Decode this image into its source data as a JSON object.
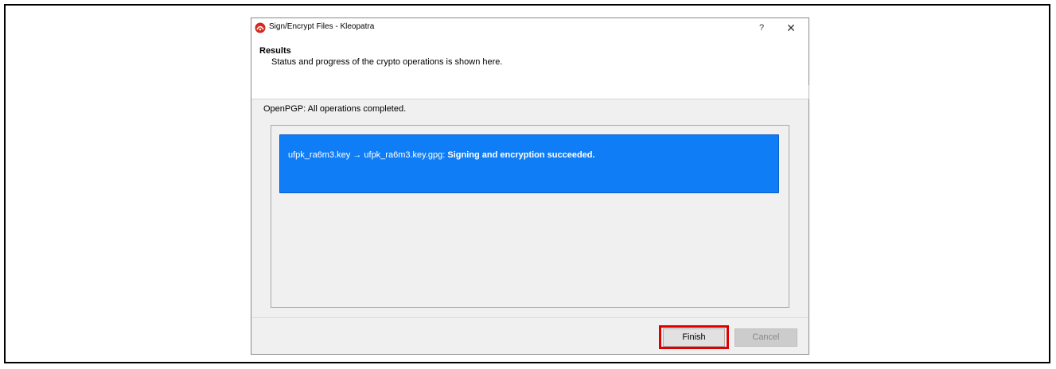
{
  "window": {
    "title": "Sign/Encrypt Files - Kleopatra",
    "help_glyph": "?",
    "close_glyph": "✕",
    "icon": "kleopatra-app-icon"
  },
  "header": {
    "title": "Results",
    "subtitle": "Status and progress of the crypto operations is shown here."
  },
  "status": "OpenPGP: All operations completed.",
  "results": [
    {
      "source": "ufpk_ra6m3.key",
      "arrow": "→",
      "target": "ufpk_ra6m3.key.gpg:",
      "message": "Signing and encryption succeeded."
    }
  ],
  "buttons": {
    "finish": "Finish",
    "cancel": "Cancel"
  },
  "colors": {
    "selection_blue": "#0f7ef6",
    "highlight_red": "#e00000"
  }
}
